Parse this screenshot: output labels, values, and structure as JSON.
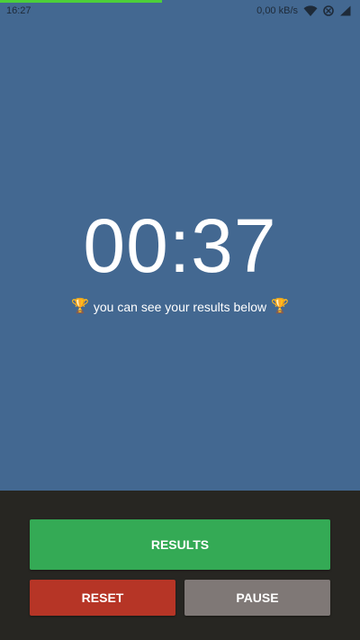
{
  "status_bar": {
    "time": "16:27",
    "network_speed": "0,00 kB/s",
    "icons": [
      "wifi-icon",
      "blocked-icon",
      "signal-icon"
    ]
  },
  "timer": {
    "display": "00:37",
    "message": "you can see your results below",
    "message_icon": "trophy-icon",
    "progress_fraction": 0.45
  },
  "buttons": {
    "results_label": "RESULTS",
    "reset_label": "RESET",
    "pause_label": "PAUSE"
  },
  "colors": {
    "background": "#436891",
    "bottom_panel": "#272622",
    "results": "#34aa55",
    "reset": "#b63526",
    "pause": "#7f7876",
    "progress": "#4ccf3a"
  }
}
